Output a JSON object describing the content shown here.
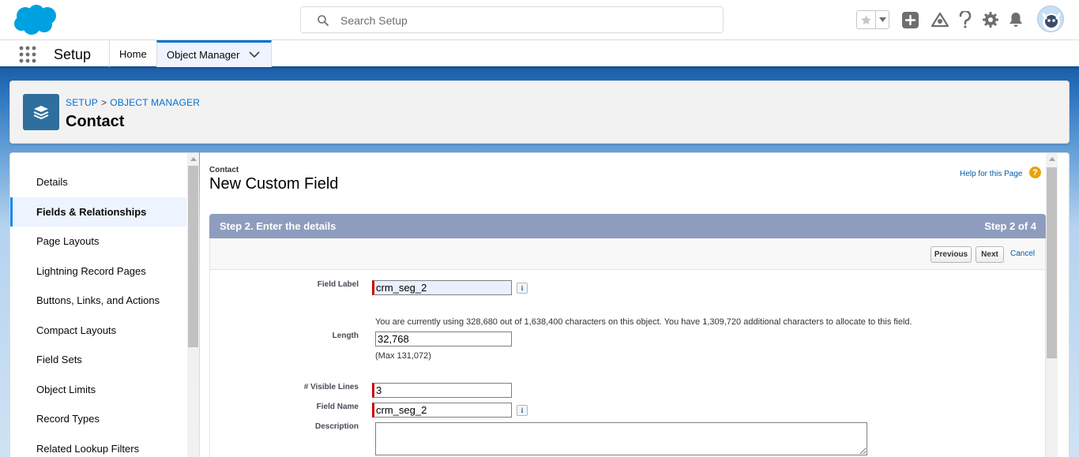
{
  "search": {
    "placeholder": "Search Setup"
  },
  "nav": {
    "app_name": "Setup",
    "tabs": [
      {
        "label": "Home"
      },
      {
        "label": "Object Manager"
      }
    ]
  },
  "header": {
    "breadcrumb": [
      "SETUP",
      "OBJECT MANAGER"
    ],
    "breadcrumb_separator": ">",
    "title": "Contact"
  },
  "sidebar": {
    "items": [
      {
        "label": "Details"
      },
      {
        "label": "Fields & Relationships",
        "active": true
      },
      {
        "label": "Page Layouts"
      },
      {
        "label": "Lightning Record Pages"
      },
      {
        "label": "Buttons, Links, and Actions"
      },
      {
        "label": "Compact Layouts"
      },
      {
        "label": "Field Sets"
      },
      {
        "label": "Object Limits"
      },
      {
        "label": "Record Types"
      },
      {
        "label": "Related Lookup Filters"
      }
    ]
  },
  "main": {
    "object_label": "Contact",
    "title": "New Custom Field",
    "help_link": "Help for this Page",
    "help_icon_glyph": "?",
    "step_title": "Step 2. Enter the details",
    "step_count": "Step 2 of 4",
    "buttons": {
      "previous": "Previous",
      "next": "Next",
      "cancel": "Cancel"
    }
  },
  "form": {
    "field_label": {
      "label": "Field Label",
      "value": "crm_seg_2"
    },
    "length": {
      "label": "Length",
      "note": "You are currently using 328,680 out of 1,638,400 characters on this object. You have 1,309,720 additional characters to allocate to this field.",
      "value": "32,768",
      "max_note": "(Max 131,072)"
    },
    "visible_lines": {
      "label": "# Visible Lines",
      "value": "3"
    },
    "field_name": {
      "label": "Field Name",
      "value": "crm_seg_2"
    },
    "description": {
      "label": "Description",
      "value": ""
    },
    "info_glyph": "i"
  },
  "colors": {
    "brand_blue": "#1b5297",
    "link_blue": "#0070d2",
    "step_bar": "#8e9dbe",
    "required_marker": "#cc0000",
    "object_icon": "#2e6f9e"
  },
  "icons": [
    "salesforce-cloud-logo",
    "search-icon",
    "favorite-star-icon",
    "chevron-down-icon",
    "add-icon",
    "trailhead-icon",
    "help-icon",
    "gear-icon",
    "bell-icon",
    "avatar",
    "app-launcher-icon",
    "layers-icon",
    "info-icon"
  ]
}
